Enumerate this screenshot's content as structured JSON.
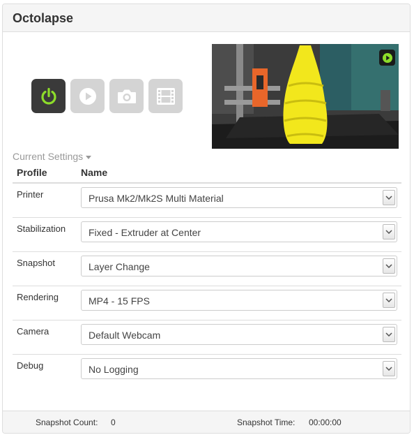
{
  "panel": {
    "title": "Octolapse"
  },
  "controls": {
    "power_icon": "power-icon",
    "play_icon": "play-icon",
    "camera_icon": "camera-icon",
    "film_icon": "film-icon",
    "power_color": "#8ddc2a"
  },
  "preview": {
    "play_icon": "play-icon",
    "play_color": "#8ddc2a"
  },
  "settings": {
    "toggle_label": "Current Settings",
    "columns": {
      "profile": "Profile",
      "name": "Name"
    },
    "rows": [
      {
        "label": "Printer",
        "value": "Prusa Mk2/Mk2S Multi Material"
      },
      {
        "label": "Stabilization",
        "value": "Fixed - Extruder at Center"
      },
      {
        "label": "Snapshot",
        "value": "Layer Change"
      },
      {
        "label": "Rendering",
        "value": "MP4 - 15 FPS"
      },
      {
        "label": "Camera",
        "value": "Default Webcam"
      },
      {
        "label": "Debug",
        "value": "No Logging"
      }
    ]
  },
  "footer": {
    "snapshot_count_label": "Snapshot Count:",
    "snapshot_count": "0",
    "snapshot_time_label": "Snapshot Time:",
    "snapshot_time": "00:00:00"
  }
}
